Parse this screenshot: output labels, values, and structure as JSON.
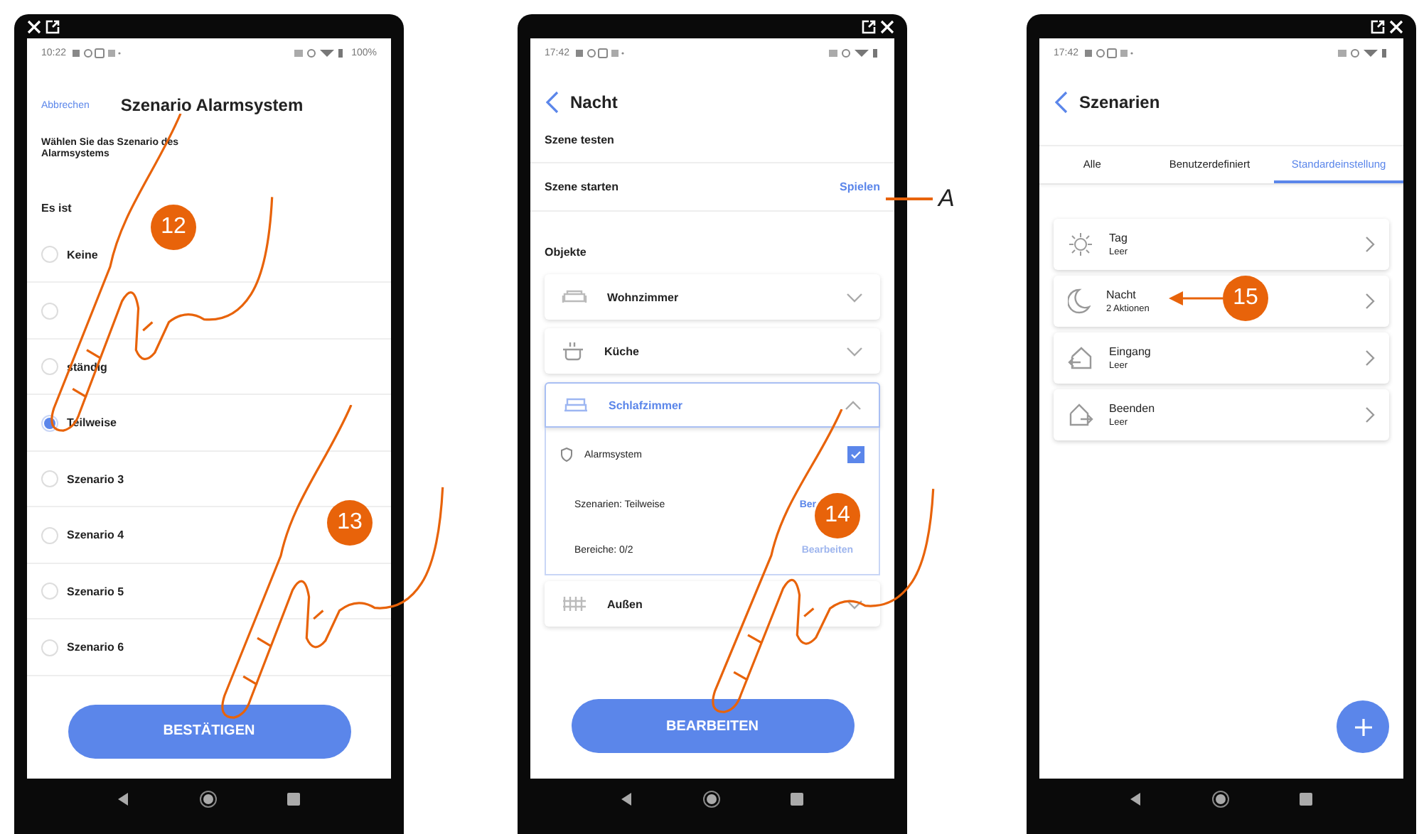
{
  "phones": [
    {
      "kind": "scenario_picker",
      "status": {
        "time": "10:22",
        "battery": "100%"
      },
      "cancel": "Abbrechen",
      "title": "Szenario Alarmsystem",
      "instruction": "Wählen Sie das Szenario des Alarmsystems",
      "section": "Es ist",
      "options": [
        {
          "label": "Keine",
          "selected": false
        },
        {
          "selected": false
        },
        {
          "label": "ständig",
          "selected": false
        },
        {
          "label": "Teilweise",
          "selected": true
        },
        {
          "label": "Szenario 3",
          "selected": false
        },
        {
          "label": "Szenario 4",
          "selected": false
        },
        {
          "label": "Szenario 5",
          "selected": false
        },
        {
          "label": "Szenario 6",
          "selected": false
        }
      ],
      "button": "BESTÄTIGEN"
    },
    {
      "kind": "scene_detail",
      "status": {
        "time": "17:42"
      },
      "title": "Nacht",
      "test_label": "Szene testen",
      "start": {
        "label": "Szene starten",
        "action": "Spielen"
      },
      "section": "Objekte",
      "rooms": [
        {
          "name": "Wohnzimmer",
          "expanded": false
        },
        {
          "name": "Küche",
          "expanded": false
        },
        {
          "name": "Schlafzimmer",
          "expanded": true,
          "device": {
            "name": "Alarmsystem",
            "checked": true
          },
          "settings": [
            {
              "label": "Szenarien: Teilweise",
              "action": "Ber",
              "dimmed": false
            },
            {
              "label": "Bereiche: 0/2",
              "action": "Bearbeiten",
              "dimmed": true
            }
          ]
        },
        {
          "name": "Außen",
          "expanded": false
        }
      ],
      "button": "BEARBEITEN"
    },
    {
      "kind": "scene_list",
      "status": {
        "time": "17:42"
      },
      "title": "Szenarien",
      "tabs": [
        {
          "label": "Alle",
          "selected": false
        },
        {
          "label": "Benutzerdefiniert",
          "selected": false
        },
        {
          "label": "Standardeinstellung",
          "selected": true
        }
      ],
      "scenes": [
        {
          "name": "Tag",
          "info": "Leer"
        },
        {
          "name": "Nacht",
          "info": "2 Aktionen"
        },
        {
          "name": "Eingang",
          "info": "Leer"
        },
        {
          "name": "Beenden",
          "info": "Leer"
        }
      ]
    }
  ],
  "steps": [
    "12",
    "13",
    "14",
    "15"
  ],
  "callout_letter": "A"
}
